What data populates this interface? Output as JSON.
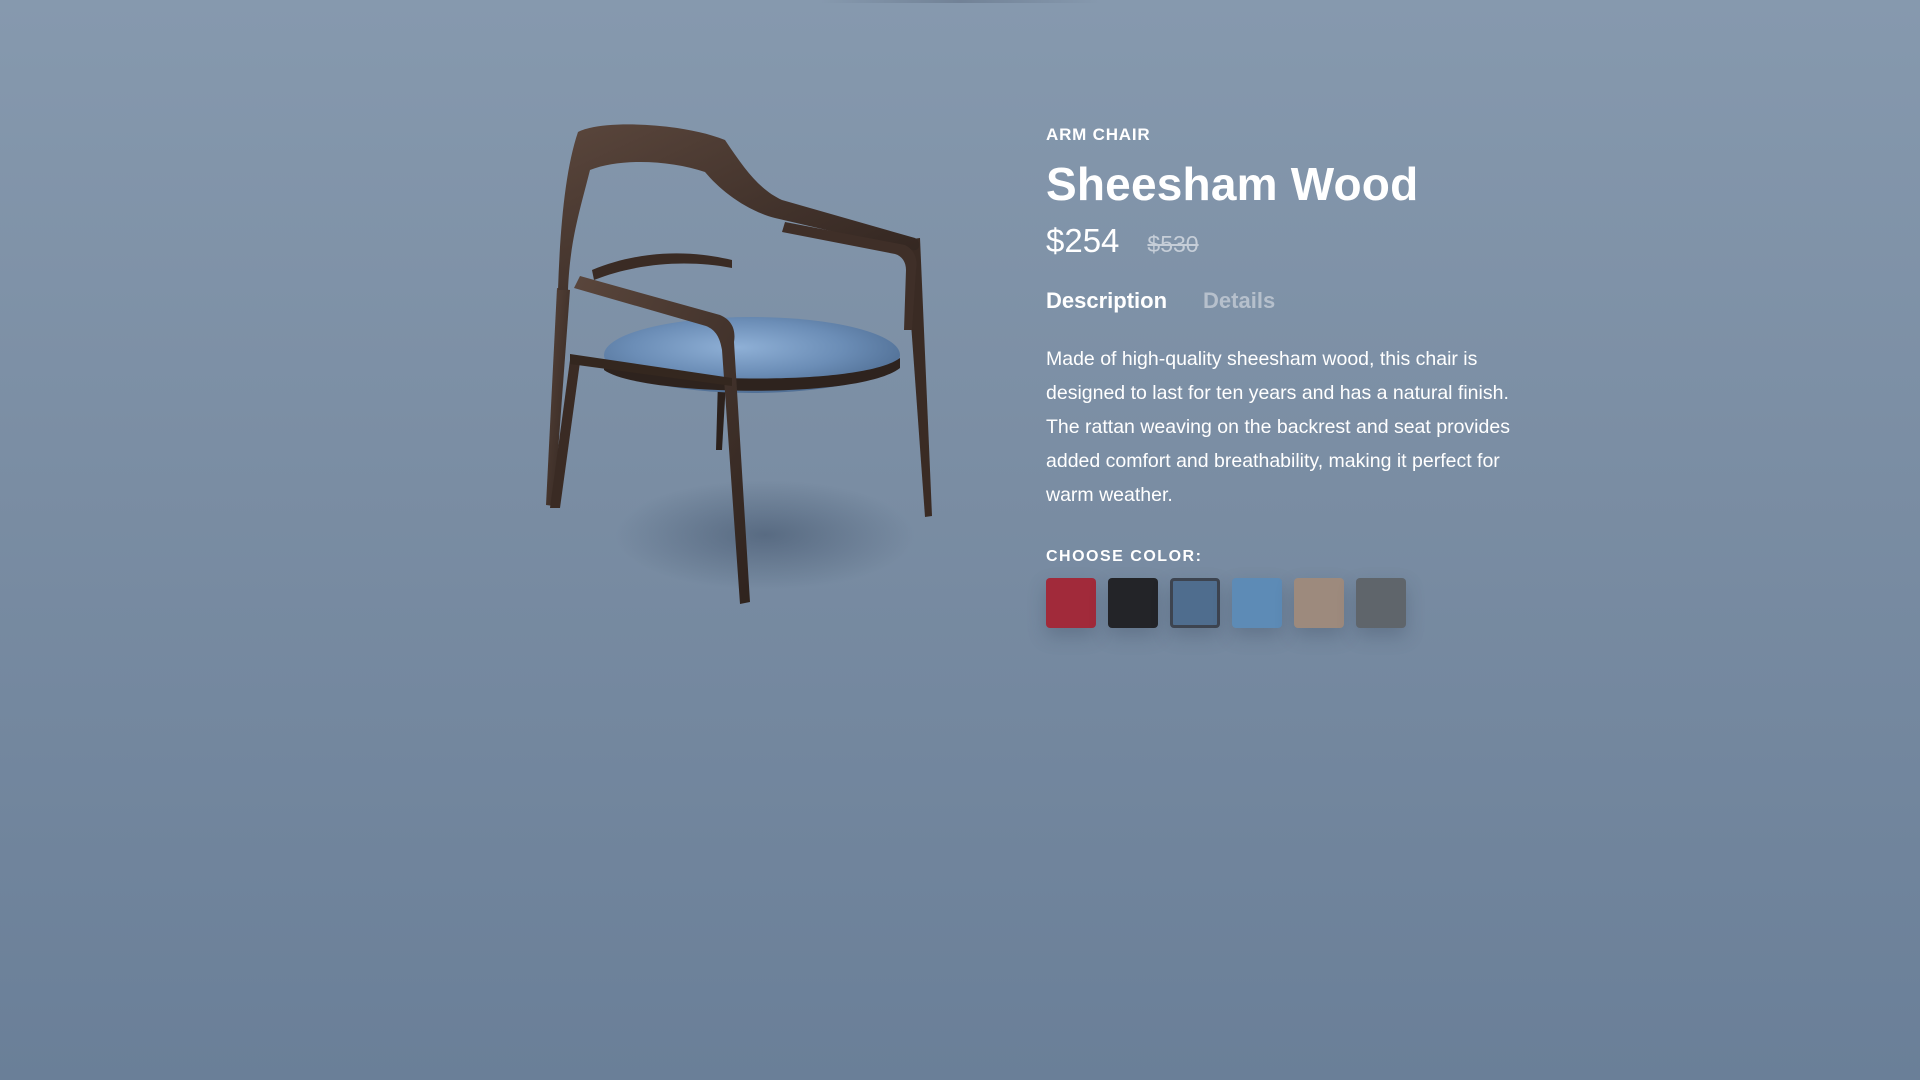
{
  "product": {
    "category": "ARM CHAIR",
    "title": "Sheesham Wood",
    "price": "$254",
    "old_price": "$530"
  },
  "tabs": [
    {
      "label": "Description",
      "active": true
    },
    {
      "label": "Details",
      "active": false
    }
  ],
  "description": "Made of high-quality sheesham wood, this chair is designed to last for ten years and has a natural finish. The rattan weaving on the backrest and seat provides added comfort and breathability, making it perfect for warm weather.",
  "color_picker": {
    "label": "CHOOSE COLOR:",
    "swatches": [
      {
        "name": "red",
        "color": "#a12a3a",
        "selected": false
      },
      {
        "name": "black",
        "color": "#232428",
        "selected": false
      },
      {
        "name": "blue-velvet",
        "color": "#4f6d8e",
        "selected": true
      },
      {
        "name": "light-blue",
        "color": "#5d8bb6",
        "selected": false
      },
      {
        "name": "beige",
        "color": "#9d8a7d",
        "selected": false
      },
      {
        "name": "gray",
        "color": "#5f656b",
        "selected": false
      }
    ]
  },
  "colors": {
    "background_top": "#8699ae",
    "background_bottom": "#6a7f98",
    "wood": "#3f2f28",
    "seat": "#6d8fb8"
  }
}
